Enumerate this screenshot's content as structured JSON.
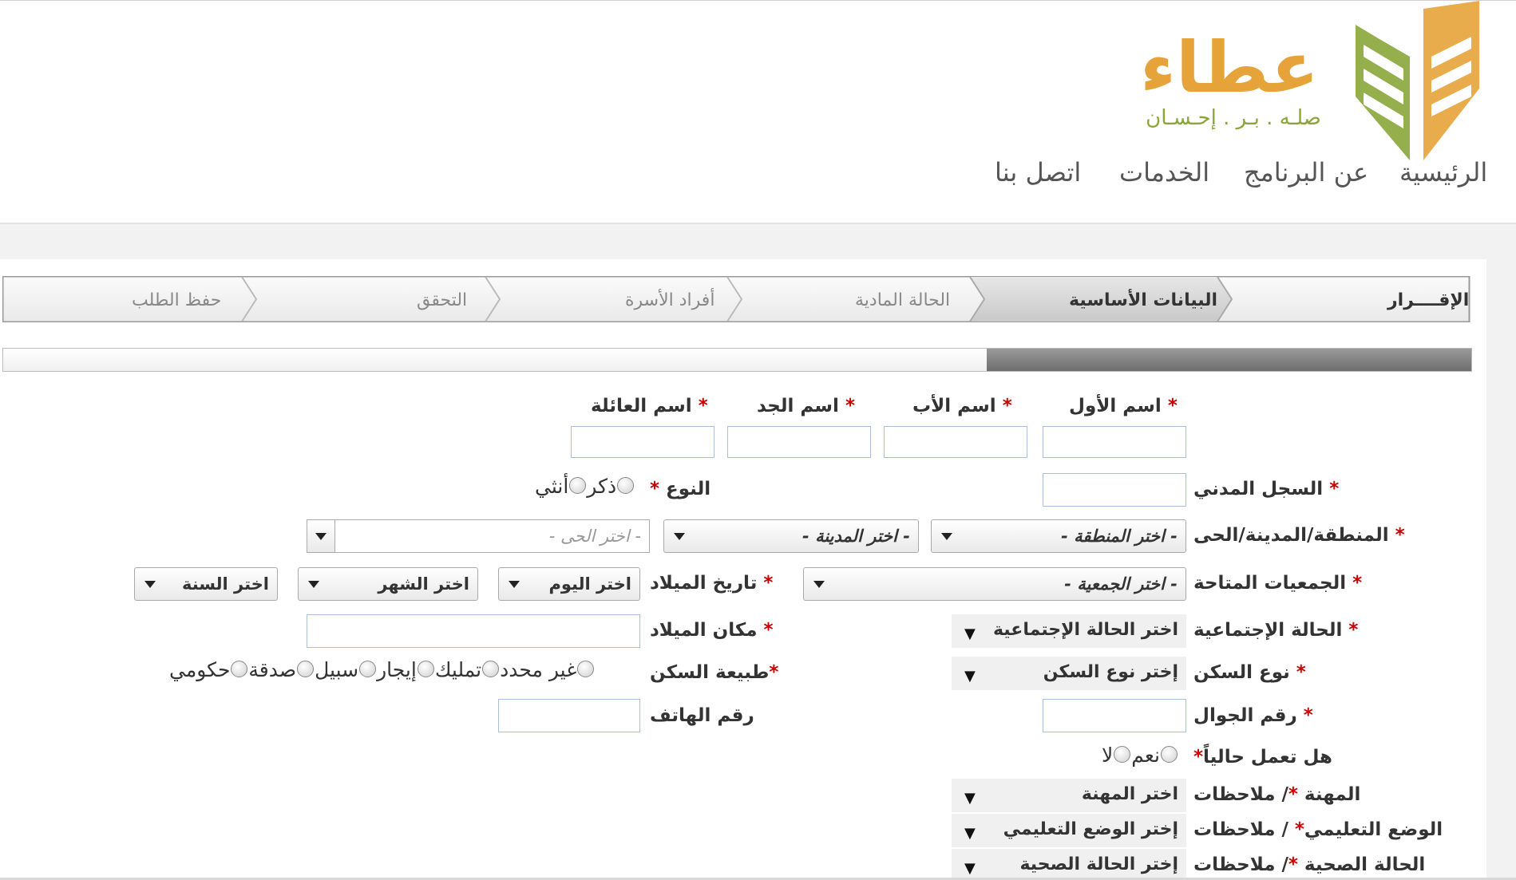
{
  "brand": {
    "name": "عطاء",
    "tagline": "صلـه . بـر . إحـسـان",
    "colors": {
      "orange": "#e6a33a",
      "green": "#8aa63a"
    }
  },
  "nav": {
    "home": "الرئيسية",
    "about": "عن البرنامج",
    "services": "الخدمات",
    "contact": "اتصل بنا"
  },
  "wizard": {
    "steps": [
      {
        "label": "الإقــــرار",
        "state": "done"
      },
      {
        "label": "البيانات الأساسية",
        "state": "active"
      },
      {
        "label": "الحالة المادية",
        "state": "pending"
      },
      {
        "label": "أفراد الأسرة",
        "state": "pending"
      },
      {
        "label": "التحقق",
        "state": "pending"
      },
      {
        "label": "حفظ الطلب",
        "state": "pending"
      }
    ]
  },
  "progress": {
    "percent": 33
  },
  "form": {
    "required_mark": "*",
    "first_name": {
      "label": "اسم الأول",
      "value": ""
    },
    "father_name": {
      "label": "اسم الأب",
      "value": ""
    },
    "grandfather_name": {
      "label": "اسم الجد",
      "value": ""
    },
    "family_name": {
      "label": "اسم العائلة",
      "value": ""
    },
    "civil_id": {
      "label": "السجل المدني",
      "value": ""
    },
    "gender": {
      "label": "النوع",
      "options": [
        "ذكر",
        "أنثي"
      ]
    },
    "location": {
      "label": "المنطقة/المدينة/الحى",
      "region": "- اختر المنطقة -",
      "city": "- اختر المدينة -",
      "district": "- اختر الحى -"
    },
    "associations": {
      "label": "الجمعيات المتاحة",
      "value": "- اختر الجمعية -"
    },
    "birth_date": {
      "label": "تاريخ الميلاد",
      "day": "اختر اليوم",
      "month": "اختر الشهر",
      "year": "اختر السنة"
    },
    "social_status": {
      "label": "الحالة الإجتماعية",
      "value": "اختر الحالة الإجتماعية"
    },
    "birth_place": {
      "label": "مكان الميلاد",
      "value": ""
    },
    "housing_type": {
      "label": "نوع السكن",
      "value": "إختر نوع السكن"
    },
    "housing_nature": {
      "label": "طبيعة السكن",
      "options": [
        "غير محدد",
        "تمليك",
        "إيجار",
        "سبيل",
        "صدقة",
        "حكومي"
      ]
    },
    "mobile": {
      "label": "رقم الجوال",
      "value": ""
    },
    "phone": {
      "label": "رقم الهاتف",
      "value": ""
    },
    "working": {
      "label": "هل تعمل حالياً",
      "options": [
        "نعم",
        "لا"
      ]
    },
    "job": {
      "label": "المهنة",
      "notes": "/ ملاحظات",
      "value": "اختر المهنة"
    },
    "education": {
      "label": "الوضع التعليمي",
      "notes": "/ ملاحظات",
      "value": "إختر الوضع التعليمي"
    },
    "health": {
      "label": "الحالة الصحية",
      "notes": "/ ملاحظات",
      "value": "إختر الحالة الصحية"
    }
  }
}
